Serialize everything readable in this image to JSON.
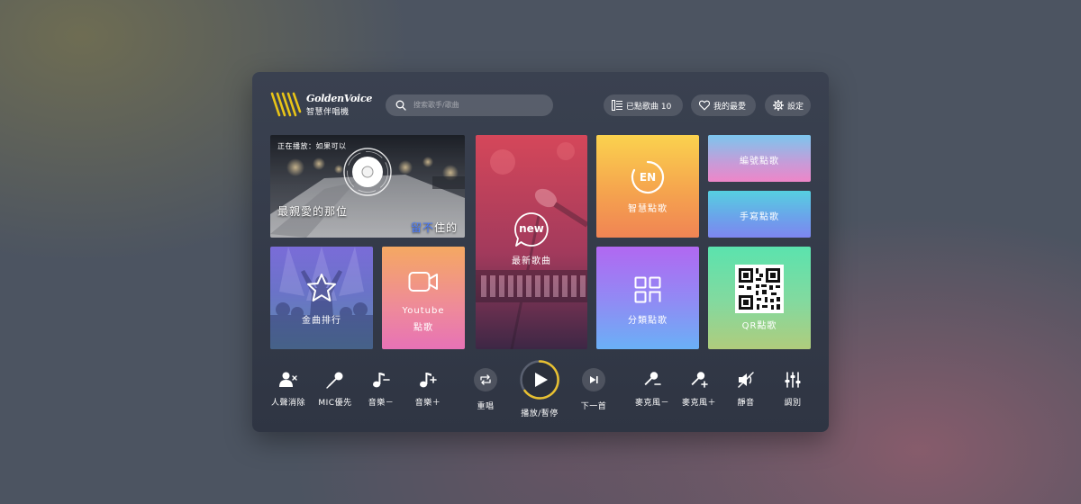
{
  "header": {
    "brand_en": "GoldenVoice",
    "brand_zh": "智慧伴唱機",
    "search_placeholder": "搜索歌手/歌曲",
    "queue_label": "已點歌曲",
    "queue_count": "10",
    "favorites_label": "我的最愛",
    "settings_label": "設定"
  },
  "now_playing": {
    "label": "正在播放：如果可以",
    "lyric_line1": "最親愛的那位",
    "lyric_line2_highlight": "留不",
    "lyric_line2_rest": "住的"
  },
  "tiles": {
    "ranking": "金曲排行",
    "youtube_line1": "Youtube",
    "youtube_line2": "點歌",
    "new_badge": "new",
    "new_songs": "最新歌曲",
    "smart_badge": "EN",
    "smart": "智慧點歌",
    "number": "編號點歌",
    "handwrite": "手寫點歌",
    "category": "分類點歌",
    "qr": "QR點歌"
  },
  "controls": {
    "vocal_remove": "人聲消除",
    "mic_priority": "MIC優先",
    "music_down": "音樂－",
    "music_up": "音樂＋",
    "repeat": "重唱",
    "play_pause": "播放/暫停",
    "next": "下一首",
    "mic_down": "麥克風－",
    "mic_up": "麥克風＋",
    "mute": "靜音",
    "tuning": "調別"
  },
  "colors": {
    "accent_gold": "#e8c030",
    "lyric_highlight": "#4a7cff"
  },
  "icons": [
    "logo-stripes",
    "search-icon",
    "list-icon",
    "heart-icon",
    "gear-icon",
    "cd-icon",
    "star-icon",
    "video-camera-icon",
    "new-chat-icon",
    "en-icon",
    "grid-icon",
    "qr-code-icon",
    "user-x-icon",
    "mic-icon",
    "music-minus-icon",
    "music-plus-icon",
    "repeat-icon",
    "play-icon",
    "skip-next-icon",
    "mic-minus-icon",
    "mic-plus-icon",
    "mute-icon",
    "sliders-icon"
  ]
}
